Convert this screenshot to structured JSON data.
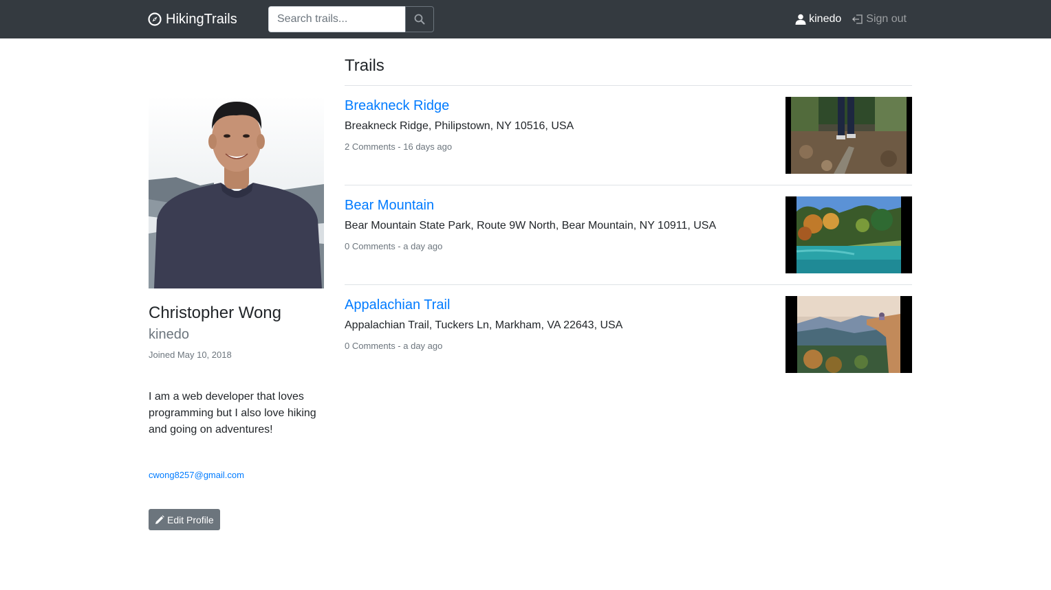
{
  "nav": {
    "brand": "HikingTrails",
    "search_placeholder": "Search trails...",
    "username": "kinedo",
    "signout": "Sign out"
  },
  "profile": {
    "name": "Christopher Wong",
    "username": "kinedo",
    "joined": "Joined May 10, 2018",
    "bio": "I am a web developer that loves programming but I also love hiking and going on adventures!",
    "email": "cwong8257@gmail.com",
    "edit_label": "Edit Profile"
  },
  "main": {
    "title": "Trails",
    "trails": [
      {
        "name": "Breakneck Ridge",
        "address": "Breakneck Ridge, Philipstown, NY 10516, USA",
        "meta": "2 Comments - 16 days ago"
      },
      {
        "name": "Bear Mountain",
        "address": "Bear Mountain State Park, Route 9W North, Bear Mountain, NY 10911, USA",
        "meta": "0 Comments - a day ago"
      },
      {
        "name": "Appalachian Trail",
        "address": "Appalachian Trail, Tuckers Ln, Markham, VA 22643, USA",
        "meta": "0 Comments - a day ago"
      }
    ]
  },
  "colors": {
    "navbar": "#343a40",
    "link": "#007bff",
    "muted": "#6c757d"
  }
}
